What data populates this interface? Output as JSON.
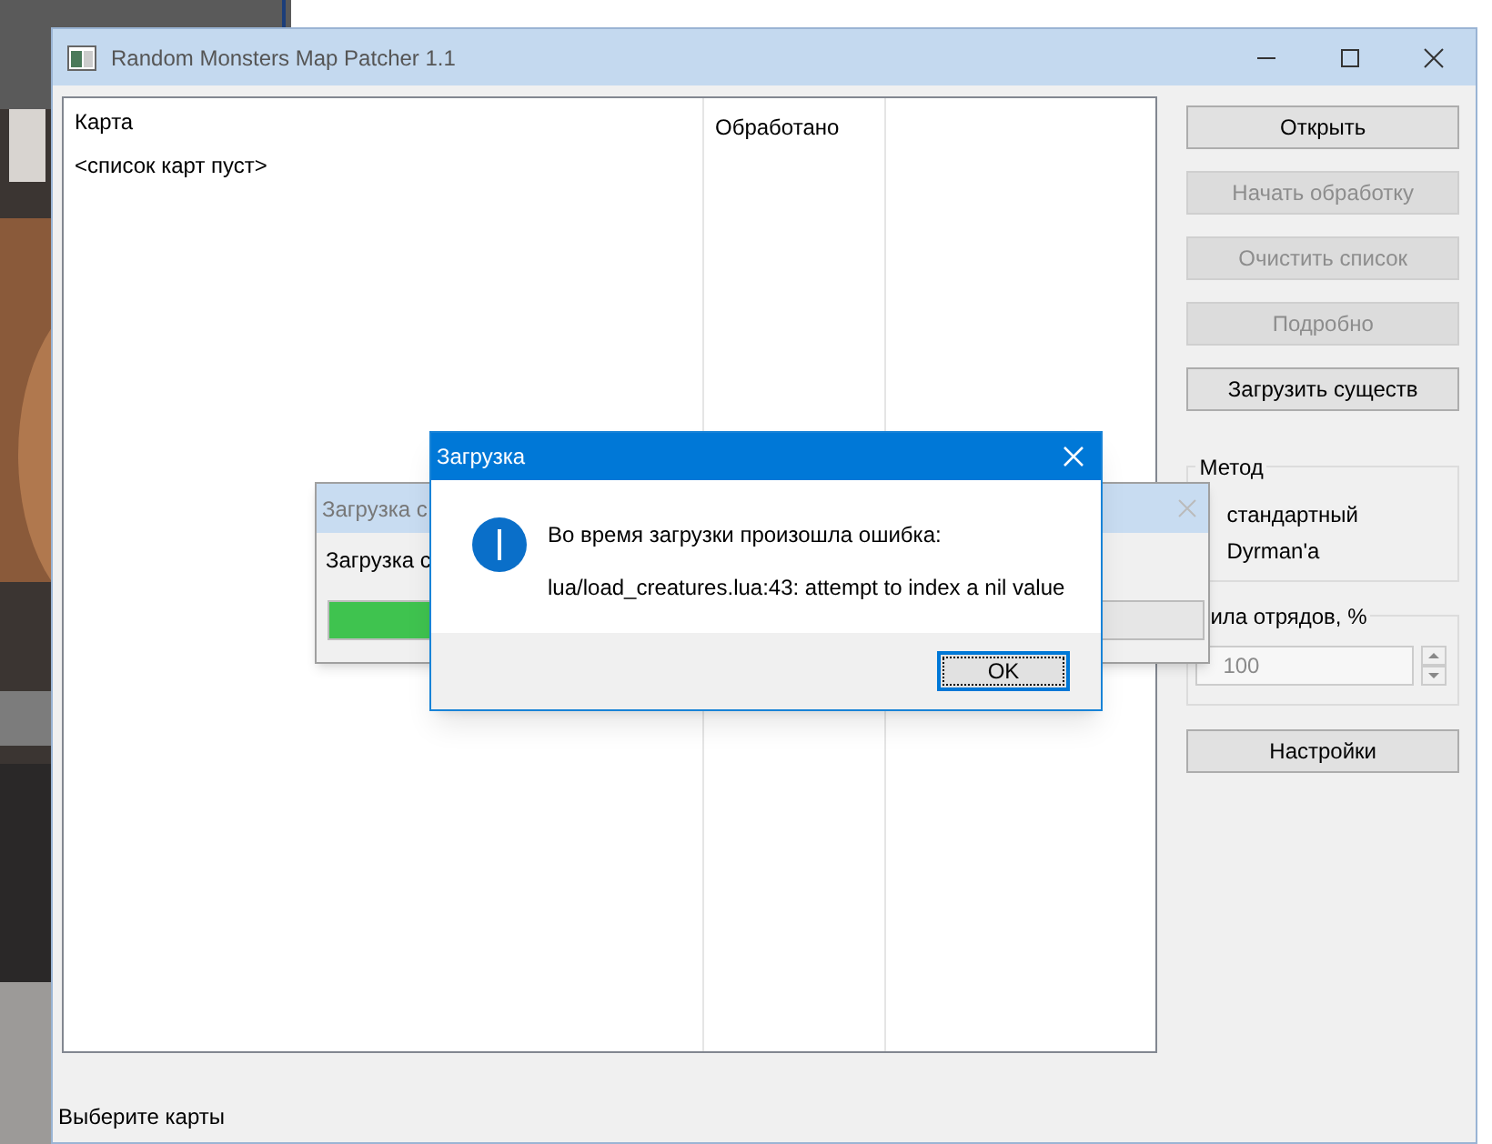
{
  "window": {
    "title": "Random Monsters Map Patcher 1.1"
  },
  "table": {
    "columns": [
      "Карта",
      "Обработано"
    ],
    "rows": [
      {
        "text": "<список карт пуст>"
      }
    ]
  },
  "buttons": [
    {
      "label": "Открыть",
      "disabled": false
    },
    {
      "label": "Начать обработку",
      "disabled": true
    },
    {
      "label": "Очистить список",
      "disabled": true
    },
    {
      "label": "Подробно",
      "disabled": true
    },
    {
      "label": "Загрузить существ",
      "disabled": false
    }
  ],
  "method_group": {
    "title": "Метод",
    "options": [
      {
        "label": "стандартный"
      },
      {
        "label": "Dyrman'a"
      }
    ]
  },
  "strength_group": {
    "title": "ила отрядов, %",
    "value": "100"
  },
  "settings_button": {
    "label": "Настройки",
    "disabled": false
  },
  "status_bar": "Выберите карты",
  "progress_dialog": {
    "title": "Загрузка с",
    "label": "Загрузка с",
    "level": 0.3
  },
  "error_dialog": {
    "title": "Загрузка",
    "lines": [
      "Во время загрузки произошла ошибка:",
      "lua/load_creatures.lua:43: attempt to index a nil value"
    ],
    "button": {
      "label": "OK",
      "focused": true
    }
  }
}
